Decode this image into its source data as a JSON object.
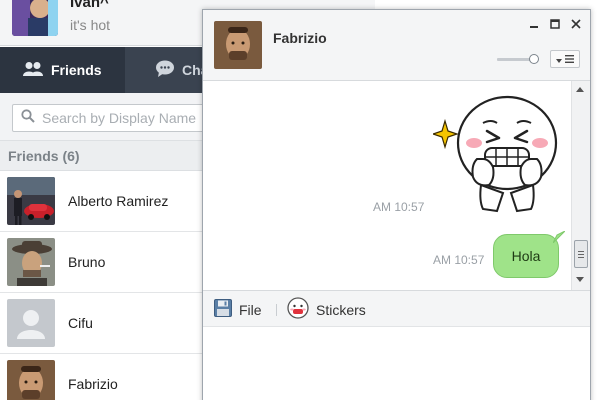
{
  "profile": {
    "name": "Ivan^",
    "status": "it's hot"
  },
  "tabs": [
    {
      "label": "Friends"
    },
    {
      "label": "Chats"
    }
  ],
  "search": {
    "placeholder": "Search by Display Name"
  },
  "friends": {
    "header": "Friends (6)",
    "items": [
      {
        "name": "Alberto Ramirez"
      },
      {
        "name": "Bruno"
      },
      {
        "name": "Cifu"
      },
      {
        "name": "Fabrizio"
      }
    ]
  },
  "chat": {
    "title": "Fabrizio",
    "volume_level_percent": 90,
    "window_buttons": {
      "minimize": "minimize-icon",
      "maximize": "maximize-icon",
      "close": "close-icon"
    },
    "messages": [
      {
        "type": "sticker",
        "time": "AM 10:57"
      },
      {
        "type": "text",
        "text": "Hola",
        "time": "AM 10:57"
      }
    ],
    "toolbar": {
      "file_label": "File",
      "stickers_label": "Stickers"
    },
    "input_value": ""
  },
  "colors": {
    "tab_bar": "#3a4350",
    "tab_active": "#2c3440",
    "bubble": "#9fe389",
    "timestamp": "#9aa0a6"
  }
}
